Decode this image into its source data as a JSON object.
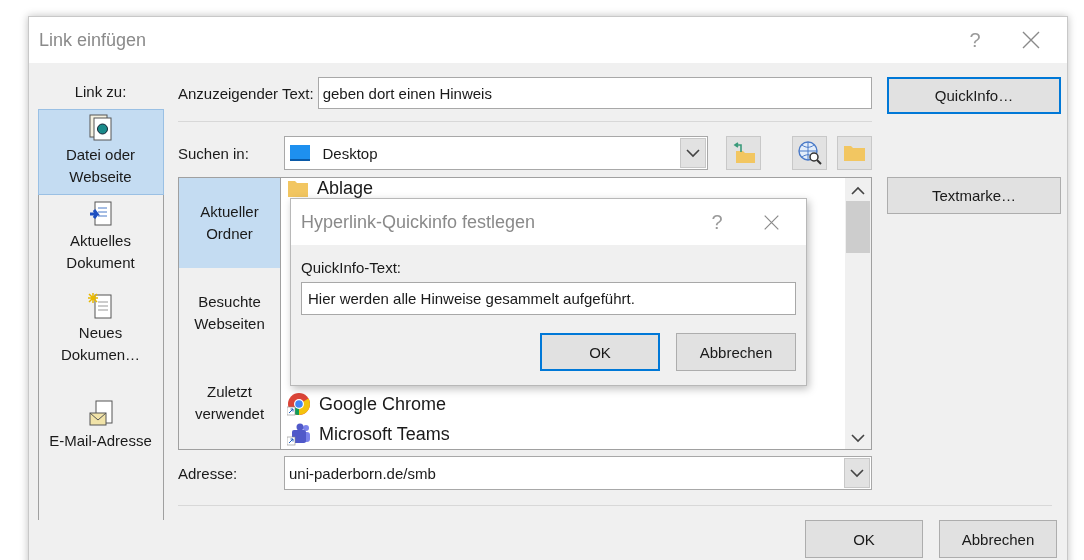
{
  "dialog": {
    "title": "Link einfügen",
    "help": "?"
  },
  "link_to": {
    "label": "Link zu:",
    "items": [
      {
        "label": "Datei oder Webseite",
        "kind": "file",
        "selected": true
      },
      {
        "label": "Aktuelles Dokument",
        "kind": "document",
        "selected": false
      },
      {
        "label": "Neues Dokumen…",
        "kind": "new",
        "selected": false
      },
      {
        "label": "E-Mail-Adresse",
        "kind": "mail",
        "selected": false
      }
    ]
  },
  "display_text": {
    "label": "Anzuzeigender Text:",
    "value": "geben dort einen Hinweis"
  },
  "look_in": {
    "label": "Suchen in:",
    "value": "Desktop"
  },
  "browse_tabs": [
    {
      "label": "Aktueller Ordner",
      "selected": true
    },
    {
      "label": "Besuchte Webseiten",
      "selected": false
    },
    {
      "label": "Zuletzt verwendet",
      "selected": false
    }
  ],
  "files": [
    {
      "name": "Ablage",
      "kind": "folder"
    },
    {
      "name": "Google Chrome",
      "kind": "chrome"
    },
    {
      "name": "Microsoft Teams",
      "kind": "teams"
    }
  ],
  "address": {
    "label": "Adresse:",
    "value": "uni-paderborn.de/smb"
  },
  "side_buttons": [
    {
      "label": "QuickInfo…",
      "focused": true
    },
    {
      "label": "Textmarke…",
      "focused": false
    }
  ],
  "buttons": [
    {
      "label": "OK"
    },
    {
      "label": "Abbrechen"
    }
  ],
  "quickinfo_dialog": {
    "title": "Hyperlink-Quickinfo festlegen",
    "help": "?",
    "field_label": "QuickInfo-Text:",
    "value": "Hier werden alle Hinweise gesammelt aufgeführt.",
    "buttons": [
      {
        "label": "OK",
        "focused": true
      },
      {
        "label": "Abbrechen",
        "focused": false
      }
    ]
  }
}
